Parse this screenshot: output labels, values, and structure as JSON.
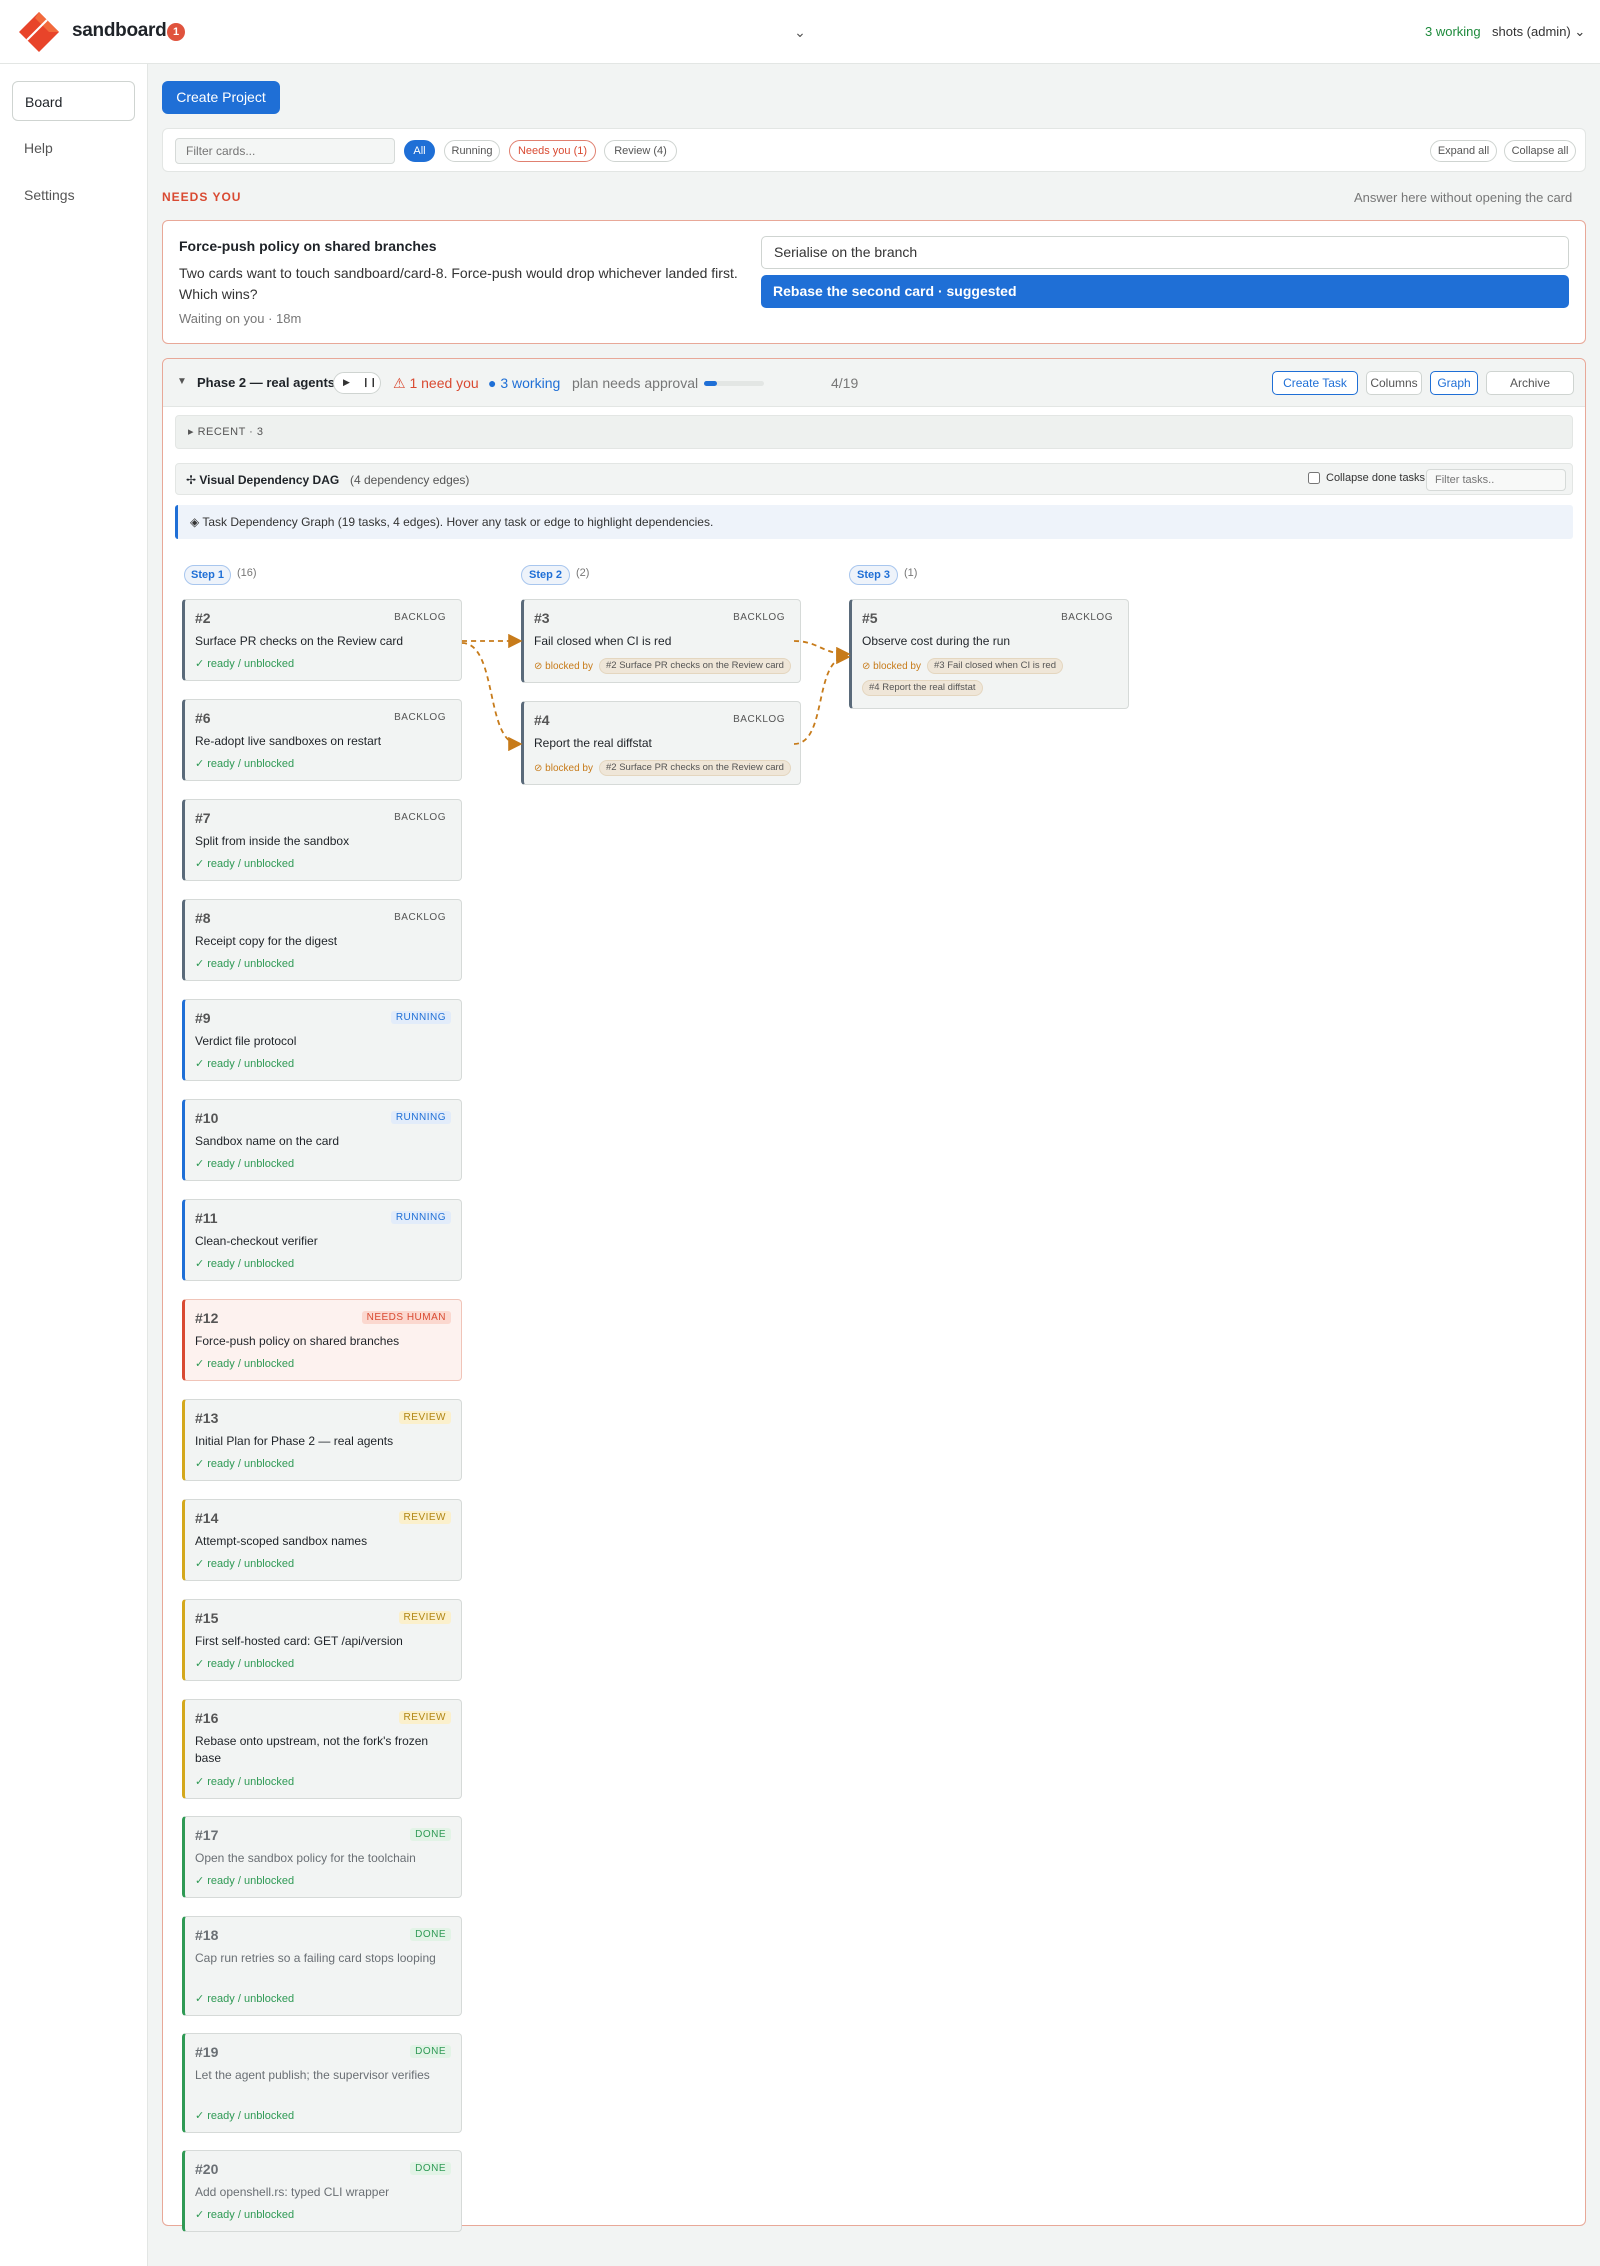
{
  "app": {
    "name": "sandboard",
    "badge": "1",
    "working_status": "3 working",
    "user": "shots (admin) ⌄"
  },
  "sidebar": {
    "items": [
      {
        "label": "Board"
      },
      {
        "label": "Help"
      },
      {
        "label": "Settings"
      }
    ]
  },
  "toolbar": {
    "create_project": "Create Project"
  },
  "filter": {
    "placeholder": "Filter cards...",
    "pills": [
      {
        "label": "All"
      },
      {
        "label": "Running"
      },
      {
        "label": "Needs you (1)"
      },
      {
        "label": "Review (4)"
      }
    ],
    "expand_all": "Expand all",
    "collapse_all": "Collapse all"
  },
  "needs_you": {
    "heading": "NEEDS YOU",
    "hint": "Answer here without opening the card",
    "question": {
      "title": "Force-push policy on shared branches",
      "body": "Two cards want to touch sandboard/card-8. Force-push would drop whichever landed first. Which wins?",
      "waiting": "Waiting on you · 18m",
      "answer_value": "Serialise on the branch",
      "suggestion": "Rebase the second card · suggested"
    }
  },
  "project": {
    "caret": "▼",
    "title": "Phase 2 — real agents",
    "play": "▶",
    "pause": "❙❙",
    "need_you": "⚠ 1 need you",
    "working": "● 3 working",
    "plan_status": "plan needs approval",
    "progress_fraction": 0.21,
    "progress_count": "4/19",
    "buttons": {
      "create_task": "Create Task",
      "columns": "Columns",
      "graph": "Graph",
      "archive": "Archive"
    },
    "recent": "▸ RECENT · 3",
    "dag": {
      "title": "✢ Visual Dependency DAG",
      "edges": "(4 dependency edges)",
      "collapse_done": "Collapse done tasks",
      "filter_placeholder": "Filter tasks..",
      "info": "◈ Task Dependency Graph (19 tasks, 4 edges). Hover any task or edge to highlight dependencies."
    },
    "steps": [
      {
        "label": "Step 1",
        "count": "(16)"
      },
      {
        "label": "Step 2",
        "count": "(2)"
      },
      {
        "label": "Step 3",
        "count": "(1)"
      }
    ],
    "step1_tasks": [
      {
        "id": "#2",
        "status": "BACKLOG",
        "kind": "backlog",
        "title": "Surface PR checks on the Review card",
        "ready": "✓ ready / unblocked"
      },
      {
        "id": "#6",
        "status": "BACKLOG",
        "kind": "backlog",
        "title": "Re-adopt live sandboxes on restart",
        "ready": "✓ ready / unblocked"
      },
      {
        "id": "#7",
        "status": "BACKLOG",
        "kind": "backlog",
        "title": "Split from inside the sandbox",
        "ready": "✓ ready / unblocked"
      },
      {
        "id": "#8",
        "status": "BACKLOG",
        "kind": "backlog",
        "title": "Receipt copy for the digest",
        "ready": "✓ ready / unblocked"
      },
      {
        "id": "#9",
        "status": "RUNNING",
        "kind": "running",
        "title": "Verdict file protocol",
        "ready": "✓ ready / unblocked"
      },
      {
        "id": "#10",
        "status": "RUNNING",
        "kind": "running",
        "title": "Sandbox name on the card",
        "ready": "✓ ready / unblocked"
      },
      {
        "id": "#11",
        "status": "RUNNING",
        "kind": "running",
        "title": "Clean-checkout verifier",
        "ready": "✓ ready / unblocked"
      },
      {
        "id": "#12",
        "status": "NEEDS HUMAN",
        "kind": "human",
        "title": "Force-push policy on shared branches",
        "ready": "✓ ready / unblocked"
      },
      {
        "id": "#13",
        "status": "REVIEW",
        "kind": "review",
        "title": "Initial Plan for Phase 2 — real agents",
        "ready": "✓ ready / unblocked"
      },
      {
        "id": "#14",
        "status": "REVIEW",
        "kind": "review",
        "title": "Attempt-scoped sandbox names",
        "ready": "✓ ready / unblocked"
      },
      {
        "id": "#15",
        "status": "REVIEW",
        "kind": "review",
        "title": "First self-hosted card: GET /api/version",
        "ready": "✓ ready / unblocked"
      },
      {
        "id": "#16",
        "status": "REVIEW",
        "kind": "review",
        "title": "Rebase onto upstream, not the fork's frozen base",
        "ready": "✓ ready / unblocked"
      },
      {
        "id": "#17",
        "status": "DONE",
        "kind": "done",
        "title": "Open the sandbox policy for the toolchain",
        "ready": "✓ ready / unblocked"
      },
      {
        "id": "#18",
        "status": "DONE",
        "kind": "done",
        "title": "Cap run retries so a failing card stops looping",
        "ready": "✓ ready / unblocked"
      },
      {
        "id": "#19",
        "status": "DONE",
        "kind": "done",
        "title": "Let the agent publish; the supervisor verifies",
        "ready": "✓ ready / unblocked"
      },
      {
        "id": "#20",
        "status": "DONE",
        "kind": "done",
        "title": "Add openshell.rs: typed CLI wrapper",
        "ready": "✓ ready / unblocked"
      }
    ],
    "step2_tasks": [
      {
        "id": "#3",
        "status": "BACKLOG",
        "title": "Fail closed when CI is red",
        "blocked_by": "⊘ blocked by",
        "deps": [
          "#2 Surface PR checks on the Review card"
        ]
      },
      {
        "id": "#4",
        "status": "BACKLOG",
        "title": "Report the real diffstat",
        "blocked_by": "⊘ blocked by",
        "deps": [
          "#2 Surface PR checks on the Review card"
        ]
      }
    ],
    "step3_tasks": [
      {
        "id": "#5",
        "status": "BACKLOG",
        "title": "Observe cost during the run",
        "blocked_by": "⊘ blocked by",
        "deps": [
          "#3 Fail closed when CI is red",
          "#4 Report the real diffstat"
        ]
      }
    ]
  },
  "colors": {
    "accent": "#1f6fd6",
    "alert": "#d94a32",
    "working": "#1e8a3c",
    "edge": "#c77b1a"
  }
}
